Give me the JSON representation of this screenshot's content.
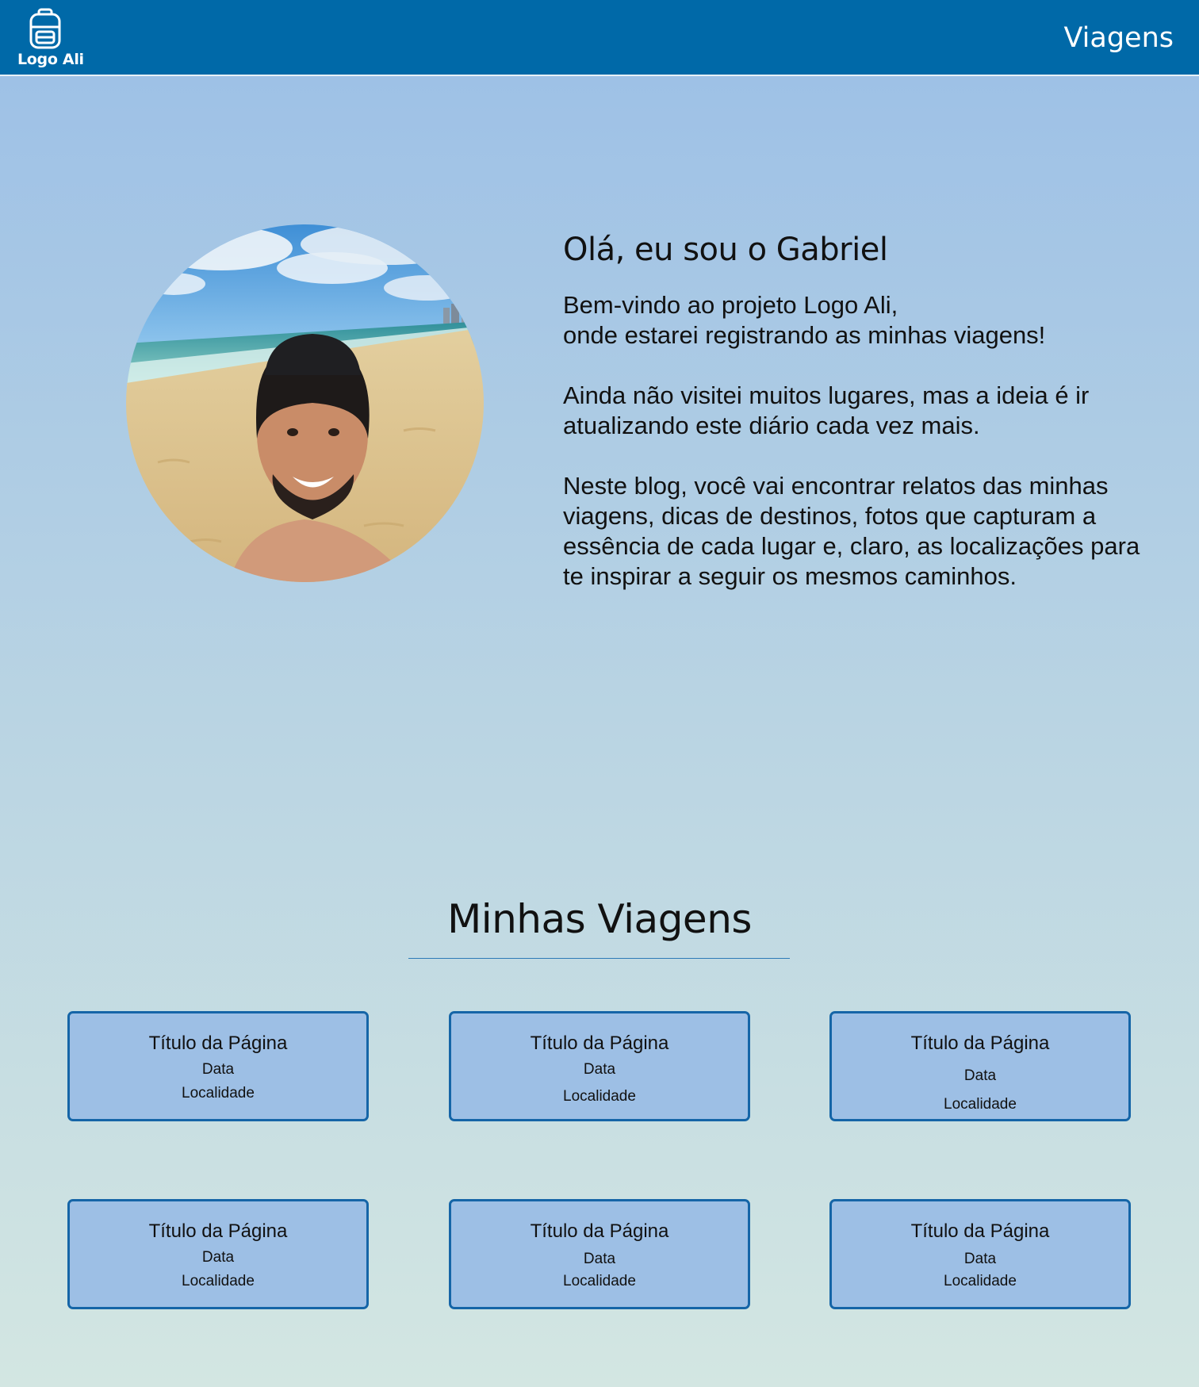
{
  "header": {
    "logo_label": "Logo Ali",
    "logo_icon": "backpack-icon",
    "nav_link": "Viagens"
  },
  "hero": {
    "photo": "profile-photo-beach",
    "title": "Olá, eu sou o Gabriel",
    "paragraphs": [
      {
        "lines": [
          "Bem-vindo ao projeto Logo Ali,",
          "onde estarei registrando as minhas viagens!"
        ]
      },
      {
        "lines": [
          "Ainda não visitei muitos lugares, mas a ideia é ir",
          "atualizando este diário cada vez mais."
        ]
      },
      {
        "lines": [
          "Neste blog, você vai encontrar relatos das minhas",
          "viagens, dicas de destinos, fotos que capturam a",
          "essência de cada lugar e, claro, as localizações para",
          "te inspirar a seguir os mesmos caminhos."
        ]
      }
    ]
  },
  "trips": {
    "title": "Minhas Viagens",
    "cards": [
      {
        "title": "Título da Página",
        "date": "Data",
        "location": "Localidade"
      },
      {
        "title": "Título da Página",
        "date": "Data",
        "location": "Localidade"
      },
      {
        "title": "Título da Página",
        "date": "Data",
        "location": "Localidade"
      },
      {
        "title": "Título da Página",
        "date": "Data",
        "location": "Localidade"
      },
      {
        "title": "Título da Página",
        "date": "Data",
        "location": "Localidade"
      },
      {
        "title": "Título da Página",
        "date": "Data",
        "location": "Localidade"
      }
    ]
  },
  "colors": {
    "header_bg": "#0069a8",
    "card_bg": "#9dbfe5",
    "card_border": "#1565a7",
    "text": "#111111"
  }
}
